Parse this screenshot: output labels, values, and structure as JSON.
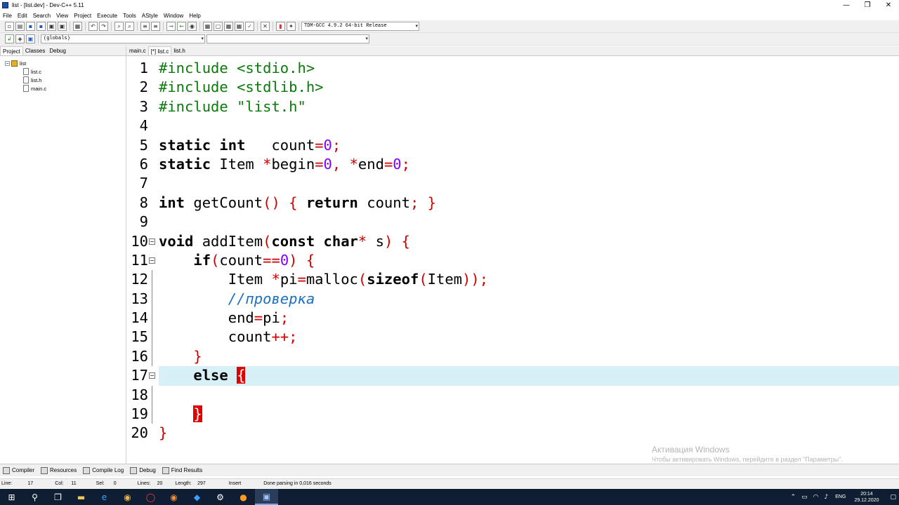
{
  "window": {
    "title": "list - [list.dev] - Dev-C++ 5.11",
    "minimize": "—",
    "maximize": "❐",
    "close": "✕"
  },
  "menu": [
    "File",
    "Edit",
    "Search",
    "View",
    "Project",
    "Execute",
    "Tools",
    "AStyle",
    "Window",
    "Help"
  ],
  "toolbar": {
    "compiler_select": "TDM-GCC 4.9.2 64-bit Release",
    "scope_select": "(globals)",
    "function_select": ""
  },
  "left_panel": {
    "tabs": [
      "Project",
      "Classes",
      "Debug"
    ],
    "project": "list",
    "files": [
      "list.c",
      "list.h",
      "main.c"
    ]
  },
  "editor": {
    "tabs": [
      "main.c",
      "[*] list.c",
      "list.h"
    ],
    "lines": [
      {
        "n": "1"
      },
      {
        "n": "2"
      },
      {
        "n": "3"
      },
      {
        "n": "4"
      },
      {
        "n": "5"
      },
      {
        "n": "6"
      },
      {
        "n": "7"
      },
      {
        "n": "8"
      },
      {
        "n": "9"
      },
      {
        "n": "10"
      },
      {
        "n": "11"
      },
      {
        "n": "12"
      },
      {
        "n": "13"
      },
      {
        "n": "14"
      },
      {
        "n": "15"
      },
      {
        "n": "16"
      },
      {
        "n": "17"
      },
      {
        "n": "18"
      },
      {
        "n": "19"
      },
      {
        "n": "20"
      }
    ],
    "code": {
      "l1a": "#include ",
      "l1b": "<stdio.h>",
      "l2a": "#include ",
      "l2b": "<stdlib.h>",
      "l3a": "#include ",
      "l3b": "\"list.h\"",
      "static": "static",
      "int": "int",
      "count": "count",
      "eq": "=",
      "zero": "0",
      "semi": ";",
      "Item": "Item",
      "star": "*",
      "begin": "begin",
      "comma": ",",
      "end": "end",
      "getCount": "getCount",
      "parens": "()",
      "lbrace": "{",
      "return": "return",
      "rbrace": "}",
      "void": "void",
      "addItem": "addItem",
      "lparen": "(",
      "const": "const",
      "char": "char",
      "s": "s",
      "rparen": ")",
      "if": "if",
      "eqeq": "==",
      "pi": "pi",
      "malloc": "malloc",
      "sizeof": "sizeof",
      "rparen2": "))",
      "comment": "//проверка",
      "plusplus": "++",
      "else": "else"
    }
  },
  "bottom_tabs": [
    "Compiler",
    "Resources",
    "Compile Log",
    "Debug",
    "Find Results"
  ],
  "status": {
    "line_label": "Line:",
    "line": "17",
    "col_label": "Col:",
    "col": "11",
    "sel_label": "Sel:",
    "sel": "0",
    "lines_label": "Lines:",
    "lines": "20",
    "length_label": "Length:",
    "length": "297",
    "mode": "Insert",
    "message": "Done parsing in 0,016 seconds"
  },
  "watermark": {
    "title": "Активация Windows",
    "subtitle": "Чтобы активировать Windows, перейдите в раздел \"Параметры\"."
  },
  "taskbar": {
    "lang": "ENG",
    "time": "20:14",
    "date": "29.12.2020"
  }
}
